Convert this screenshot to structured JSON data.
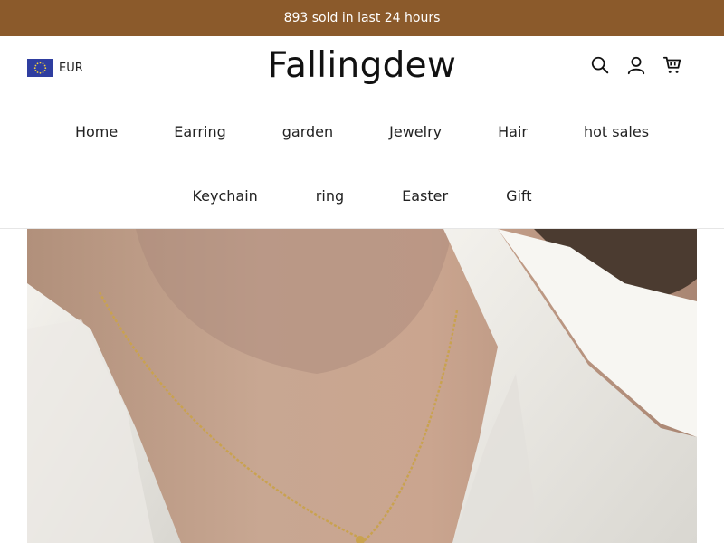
{
  "announcement": "893 sold in last 24 hours",
  "currency": {
    "code": "EUR",
    "flag_icon": "eu-flag-icon"
  },
  "brand": {
    "logo_text": "Fallingdew"
  },
  "header_icons": [
    "search-icon",
    "account-icon",
    "cart-icon"
  ],
  "nav": {
    "row1": [
      "Home",
      "Earring",
      "garden",
      "Jewelry",
      "Hair",
      "hot sales"
    ],
    "row2": [
      "Keychain",
      "ring",
      "Easter",
      "Gift"
    ]
  },
  "colors": {
    "announcement_bg": "#8b5a2b",
    "announcement_text": "#ffffff"
  }
}
